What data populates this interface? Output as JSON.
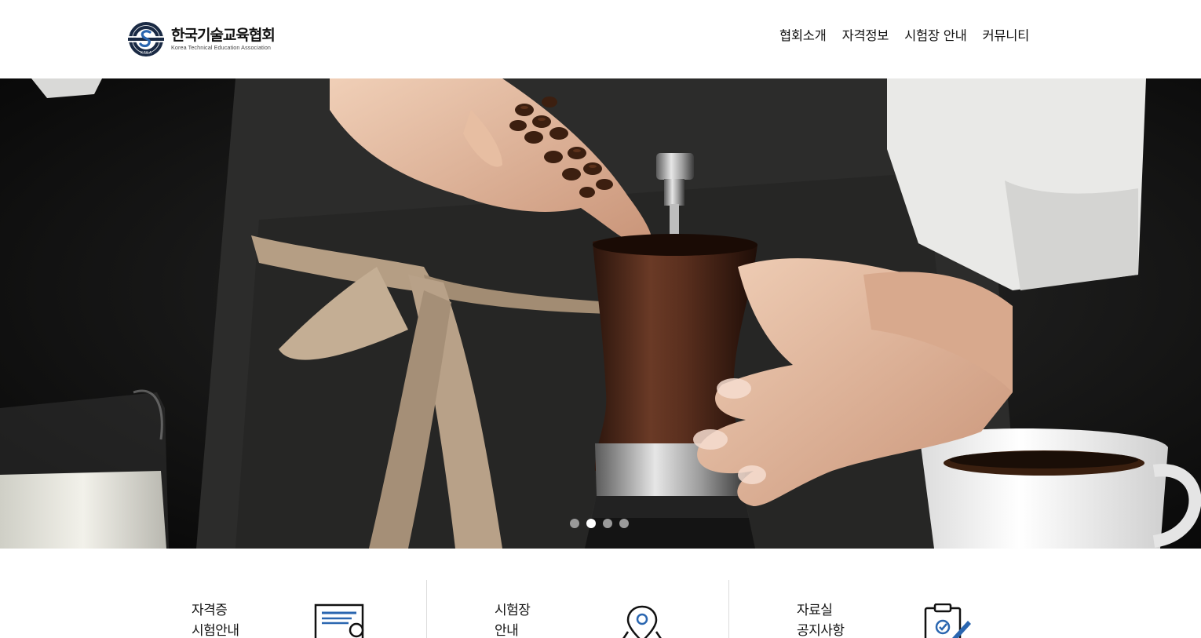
{
  "brand": {
    "name": "한국기술교육협회",
    "subtitle": "Korea Technical Education Association",
    "emblem_letters": "K.T.E.A",
    "colors": {
      "navy": "#1a2a44",
      "blue": "#2a66b0"
    }
  },
  "nav": {
    "items": [
      {
        "label": "협회소개"
      },
      {
        "label": "자격정보"
      },
      {
        "label": "시험장 안내"
      },
      {
        "label": "커뮤니티"
      }
    ]
  },
  "hero": {
    "image": "barista grinding coffee beans with a manual coffee grinder",
    "slide_count": 4,
    "active_slide": 2
  },
  "quick_links": [
    {
      "line1": "자격증",
      "line2": "시험안내",
      "icon": "certificate-icon"
    },
    {
      "line1": "시험장",
      "line2": "안내",
      "icon": "location-pin-icon"
    },
    {
      "line1": "자료실",
      "line2": "공지사항",
      "icon": "clipboard-edit-icon"
    }
  ],
  "colors": {
    "accent": "#2a66b0",
    "dot_active": "#ffffff",
    "dot_inactive": "#9a9a9a"
  }
}
